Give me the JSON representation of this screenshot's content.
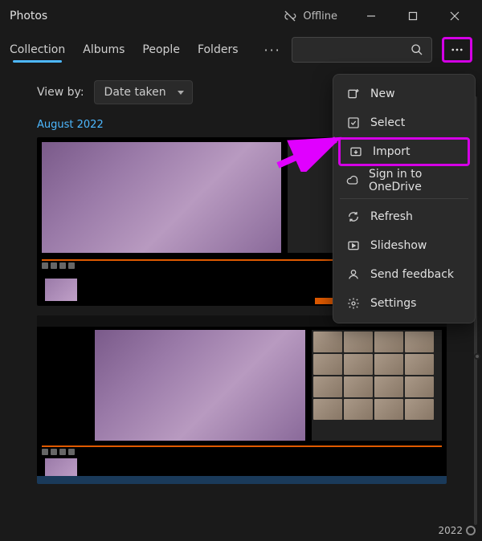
{
  "titlebar": {
    "app_name": "Photos",
    "offline_label": "Offline"
  },
  "tabs": {
    "items": [
      "Collection",
      "Albums",
      "People",
      "Folders"
    ]
  },
  "viewby": {
    "label": "View by:",
    "selected": "Date taken"
  },
  "group": {
    "header": "August 2022"
  },
  "menu": {
    "new": "New",
    "select": "Select",
    "import": "Import",
    "sign_in": "Sign in to OneDrive",
    "refresh": "Refresh",
    "slideshow": "Slideshow",
    "feedback": "Send feedback",
    "settings": "Settings"
  },
  "year_label": "2022"
}
